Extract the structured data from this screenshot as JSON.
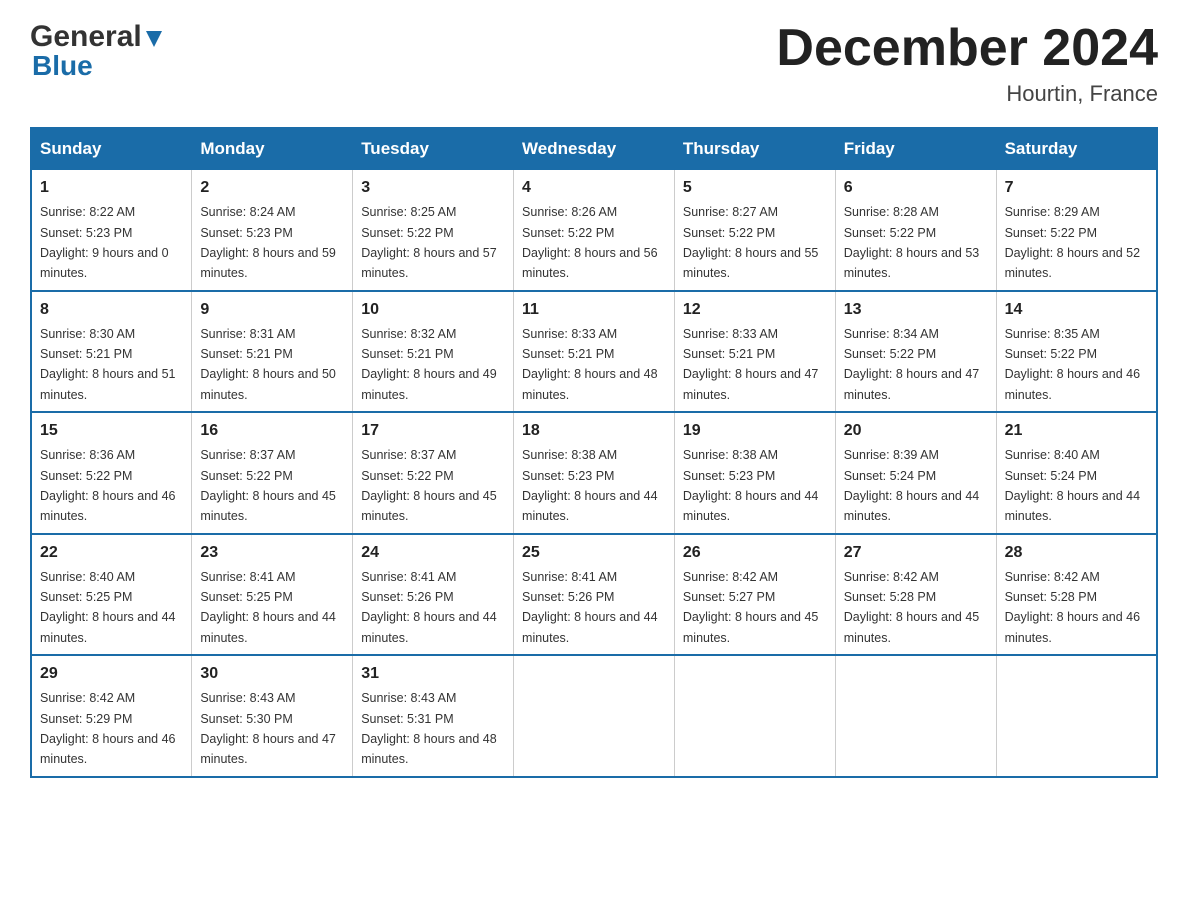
{
  "header": {
    "logo_general": "General",
    "logo_blue": "Blue",
    "month_title": "December 2024",
    "location": "Hourtin, France"
  },
  "days_of_week": [
    "Sunday",
    "Monday",
    "Tuesday",
    "Wednesday",
    "Thursday",
    "Friday",
    "Saturday"
  ],
  "weeks": [
    [
      {
        "day": "1",
        "sunrise": "8:22 AM",
        "sunset": "5:23 PM",
        "daylight": "9 hours and 0 minutes."
      },
      {
        "day": "2",
        "sunrise": "8:24 AM",
        "sunset": "5:23 PM",
        "daylight": "8 hours and 59 minutes."
      },
      {
        "day": "3",
        "sunrise": "8:25 AM",
        "sunset": "5:22 PM",
        "daylight": "8 hours and 57 minutes."
      },
      {
        "day": "4",
        "sunrise": "8:26 AM",
        "sunset": "5:22 PM",
        "daylight": "8 hours and 56 minutes."
      },
      {
        "day": "5",
        "sunrise": "8:27 AM",
        "sunset": "5:22 PM",
        "daylight": "8 hours and 55 minutes."
      },
      {
        "day": "6",
        "sunrise": "8:28 AM",
        "sunset": "5:22 PM",
        "daylight": "8 hours and 53 minutes."
      },
      {
        "day": "7",
        "sunrise": "8:29 AM",
        "sunset": "5:22 PM",
        "daylight": "8 hours and 52 minutes."
      }
    ],
    [
      {
        "day": "8",
        "sunrise": "8:30 AM",
        "sunset": "5:21 PM",
        "daylight": "8 hours and 51 minutes."
      },
      {
        "day": "9",
        "sunrise": "8:31 AM",
        "sunset": "5:21 PM",
        "daylight": "8 hours and 50 minutes."
      },
      {
        "day": "10",
        "sunrise": "8:32 AM",
        "sunset": "5:21 PM",
        "daylight": "8 hours and 49 minutes."
      },
      {
        "day": "11",
        "sunrise": "8:33 AM",
        "sunset": "5:21 PM",
        "daylight": "8 hours and 48 minutes."
      },
      {
        "day": "12",
        "sunrise": "8:33 AM",
        "sunset": "5:21 PM",
        "daylight": "8 hours and 47 minutes."
      },
      {
        "day": "13",
        "sunrise": "8:34 AM",
        "sunset": "5:22 PM",
        "daylight": "8 hours and 47 minutes."
      },
      {
        "day": "14",
        "sunrise": "8:35 AM",
        "sunset": "5:22 PM",
        "daylight": "8 hours and 46 minutes."
      }
    ],
    [
      {
        "day": "15",
        "sunrise": "8:36 AM",
        "sunset": "5:22 PM",
        "daylight": "8 hours and 46 minutes."
      },
      {
        "day": "16",
        "sunrise": "8:37 AM",
        "sunset": "5:22 PM",
        "daylight": "8 hours and 45 minutes."
      },
      {
        "day": "17",
        "sunrise": "8:37 AM",
        "sunset": "5:22 PM",
        "daylight": "8 hours and 45 minutes."
      },
      {
        "day": "18",
        "sunrise": "8:38 AM",
        "sunset": "5:23 PM",
        "daylight": "8 hours and 44 minutes."
      },
      {
        "day": "19",
        "sunrise": "8:38 AM",
        "sunset": "5:23 PM",
        "daylight": "8 hours and 44 minutes."
      },
      {
        "day": "20",
        "sunrise": "8:39 AM",
        "sunset": "5:24 PM",
        "daylight": "8 hours and 44 minutes."
      },
      {
        "day": "21",
        "sunrise": "8:40 AM",
        "sunset": "5:24 PM",
        "daylight": "8 hours and 44 minutes."
      }
    ],
    [
      {
        "day": "22",
        "sunrise": "8:40 AM",
        "sunset": "5:25 PM",
        "daylight": "8 hours and 44 minutes."
      },
      {
        "day": "23",
        "sunrise": "8:41 AM",
        "sunset": "5:25 PM",
        "daylight": "8 hours and 44 minutes."
      },
      {
        "day": "24",
        "sunrise": "8:41 AM",
        "sunset": "5:26 PM",
        "daylight": "8 hours and 44 minutes."
      },
      {
        "day": "25",
        "sunrise": "8:41 AM",
        "sunset": "5:26 PM",
        "daylight": "8 hours and 44 minutes."
      },
      {
        "day": "26",
        "sunrise": "8:42 AM",
        "sunset": "5:27 PM",
        "daylight": "8 hours and 45 minutes."
      },
      {
        "day": "27",
        "sunrise": "8:42 AM",
        "sunset": "5:28 PM",
        "daylight": "8 hours and 45 minutes."
      },
      {
        "day": "28",
        "sunrise": "8:42 AM",
        "sunset": "5:28 PM",
        "daylight": "8 hours and 46 minutes."
      }
    ],
    [
      {
        "day": "29",
        "sunrise": "8:42 AM",
        "sunset": "5:29 PM",
        "daylight": "8 hours and 46 minutes."
      },
      {
        "day": "30",
        "sunrise": "8:43 AM",
        "sunset": "5:30 PM",
        "daylight": "8 hours and 47 minutes."
      },
      {
        "day": "31",
        "sunrise": "8:43 AM",
        "sunset": "5:31 PM",
        "daylight": "8 hours and 48 minutes."
      },
      null,
      null,
      null,
      null
    ]
  ]
}
